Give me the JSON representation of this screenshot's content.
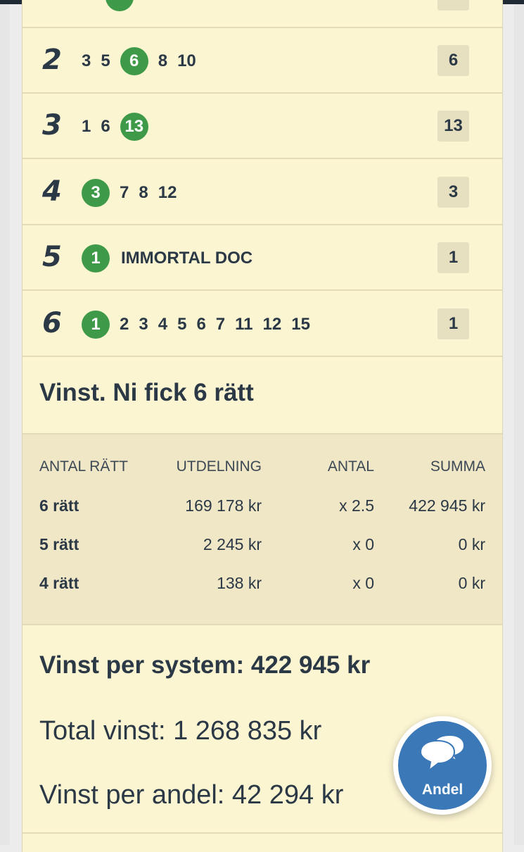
{
  "legs": [
    {
      "leg": "2",
      "horses": [
        {
          "n": "3",
          "win": false
        },
        {
          "n": "5",
          "win": false
        },
        {
          "n": "6",
          "win": true
        },
        {
          "n": "8",
          "win": false
        },
        {
          "n": "10",
          "win": false
        }
      ],
      "result": "6"
    },
    {
      "leg": "3",
      "horses": [
        {
          "n": "1",
          "win": false
        },
        {
          "n": "6",
          "win": false
        },
        {
          "n": "13",
          "win": true
        }
      ],
      "result": "13"
    },
    {
      "leg": "4",
      "horses": [
        {
          "n": "3",
          "win": true
        },
        {
          "n": "7",
          "win": false
        },
        {
          "n": "8",
          "win": false
        },
        {
          "n": "12",
          "win": false
        }
      ],
      "result": "3"
    },
    {
      "leg": "5",
      "horses": [
        {
          "n": "1",
          "win": true
        },
        {
          "n": "IMMORTAL DOC",
          "win": false
        }
      ],
      "result": "1"
    },
    {
      "leg": "6",
      "horses": [
        {
          "n": "1",
          "win": true
        },
        {
          "n": "2",
          "win": false
        },
        {
          "n": "3",
          "win": false
        },
        {
          "n": "4",
          "win": false
        },
        {
          "n": "5",
          "win": false
        },
        {
          "n": "6",
          "win": false
        },
        {
          "n": "7",
          "win": false
        },
        {
          "n": "11",
          "win": false
        },
        {
          "n": "12",
          "win": false
        },
        {
          "n": "15",
          "win": false
        }
      ],
      "result": "1"
    }
  ],
  "win_title": "Vinst. Ni fick 6 rätt",
  "payout_table": {
    "headers": [
      "ANTAL RÄTT",
      "UTDELNING",
      "ANTAL",
      "SUMMA"
    ],
    "rows": [
      [
        "6 rätt",
        "169 178 kr",
        "x 2.5",
        "422 945 kr"
      ],
      [
        "5 rätt",
        "2 245 kr",
        "x 0",
        "0 kr"
      ],
      [
        "4 rätt",
        "138 kr",
        "x 0",
        "0 kr"
      ]
    ]
  },
  "summary": {
    "per_system": "Vinst per system: 422 945 kr",
    "total": "Total vinst: 1 268 835 kr",
    "per_share": "Vinst per andel: 42 294 kr"
  },
  "chat_button": {
    "label": "Andel",
    "icon": "chat-bubbles-icon"
  },
  "colors": {
    "card_bg": "#fcf5d2",
    "winner_green": "#3e9a48",
    "chat_blue": "#3a78b8",
    "text": "#2b3845"
  }
}
